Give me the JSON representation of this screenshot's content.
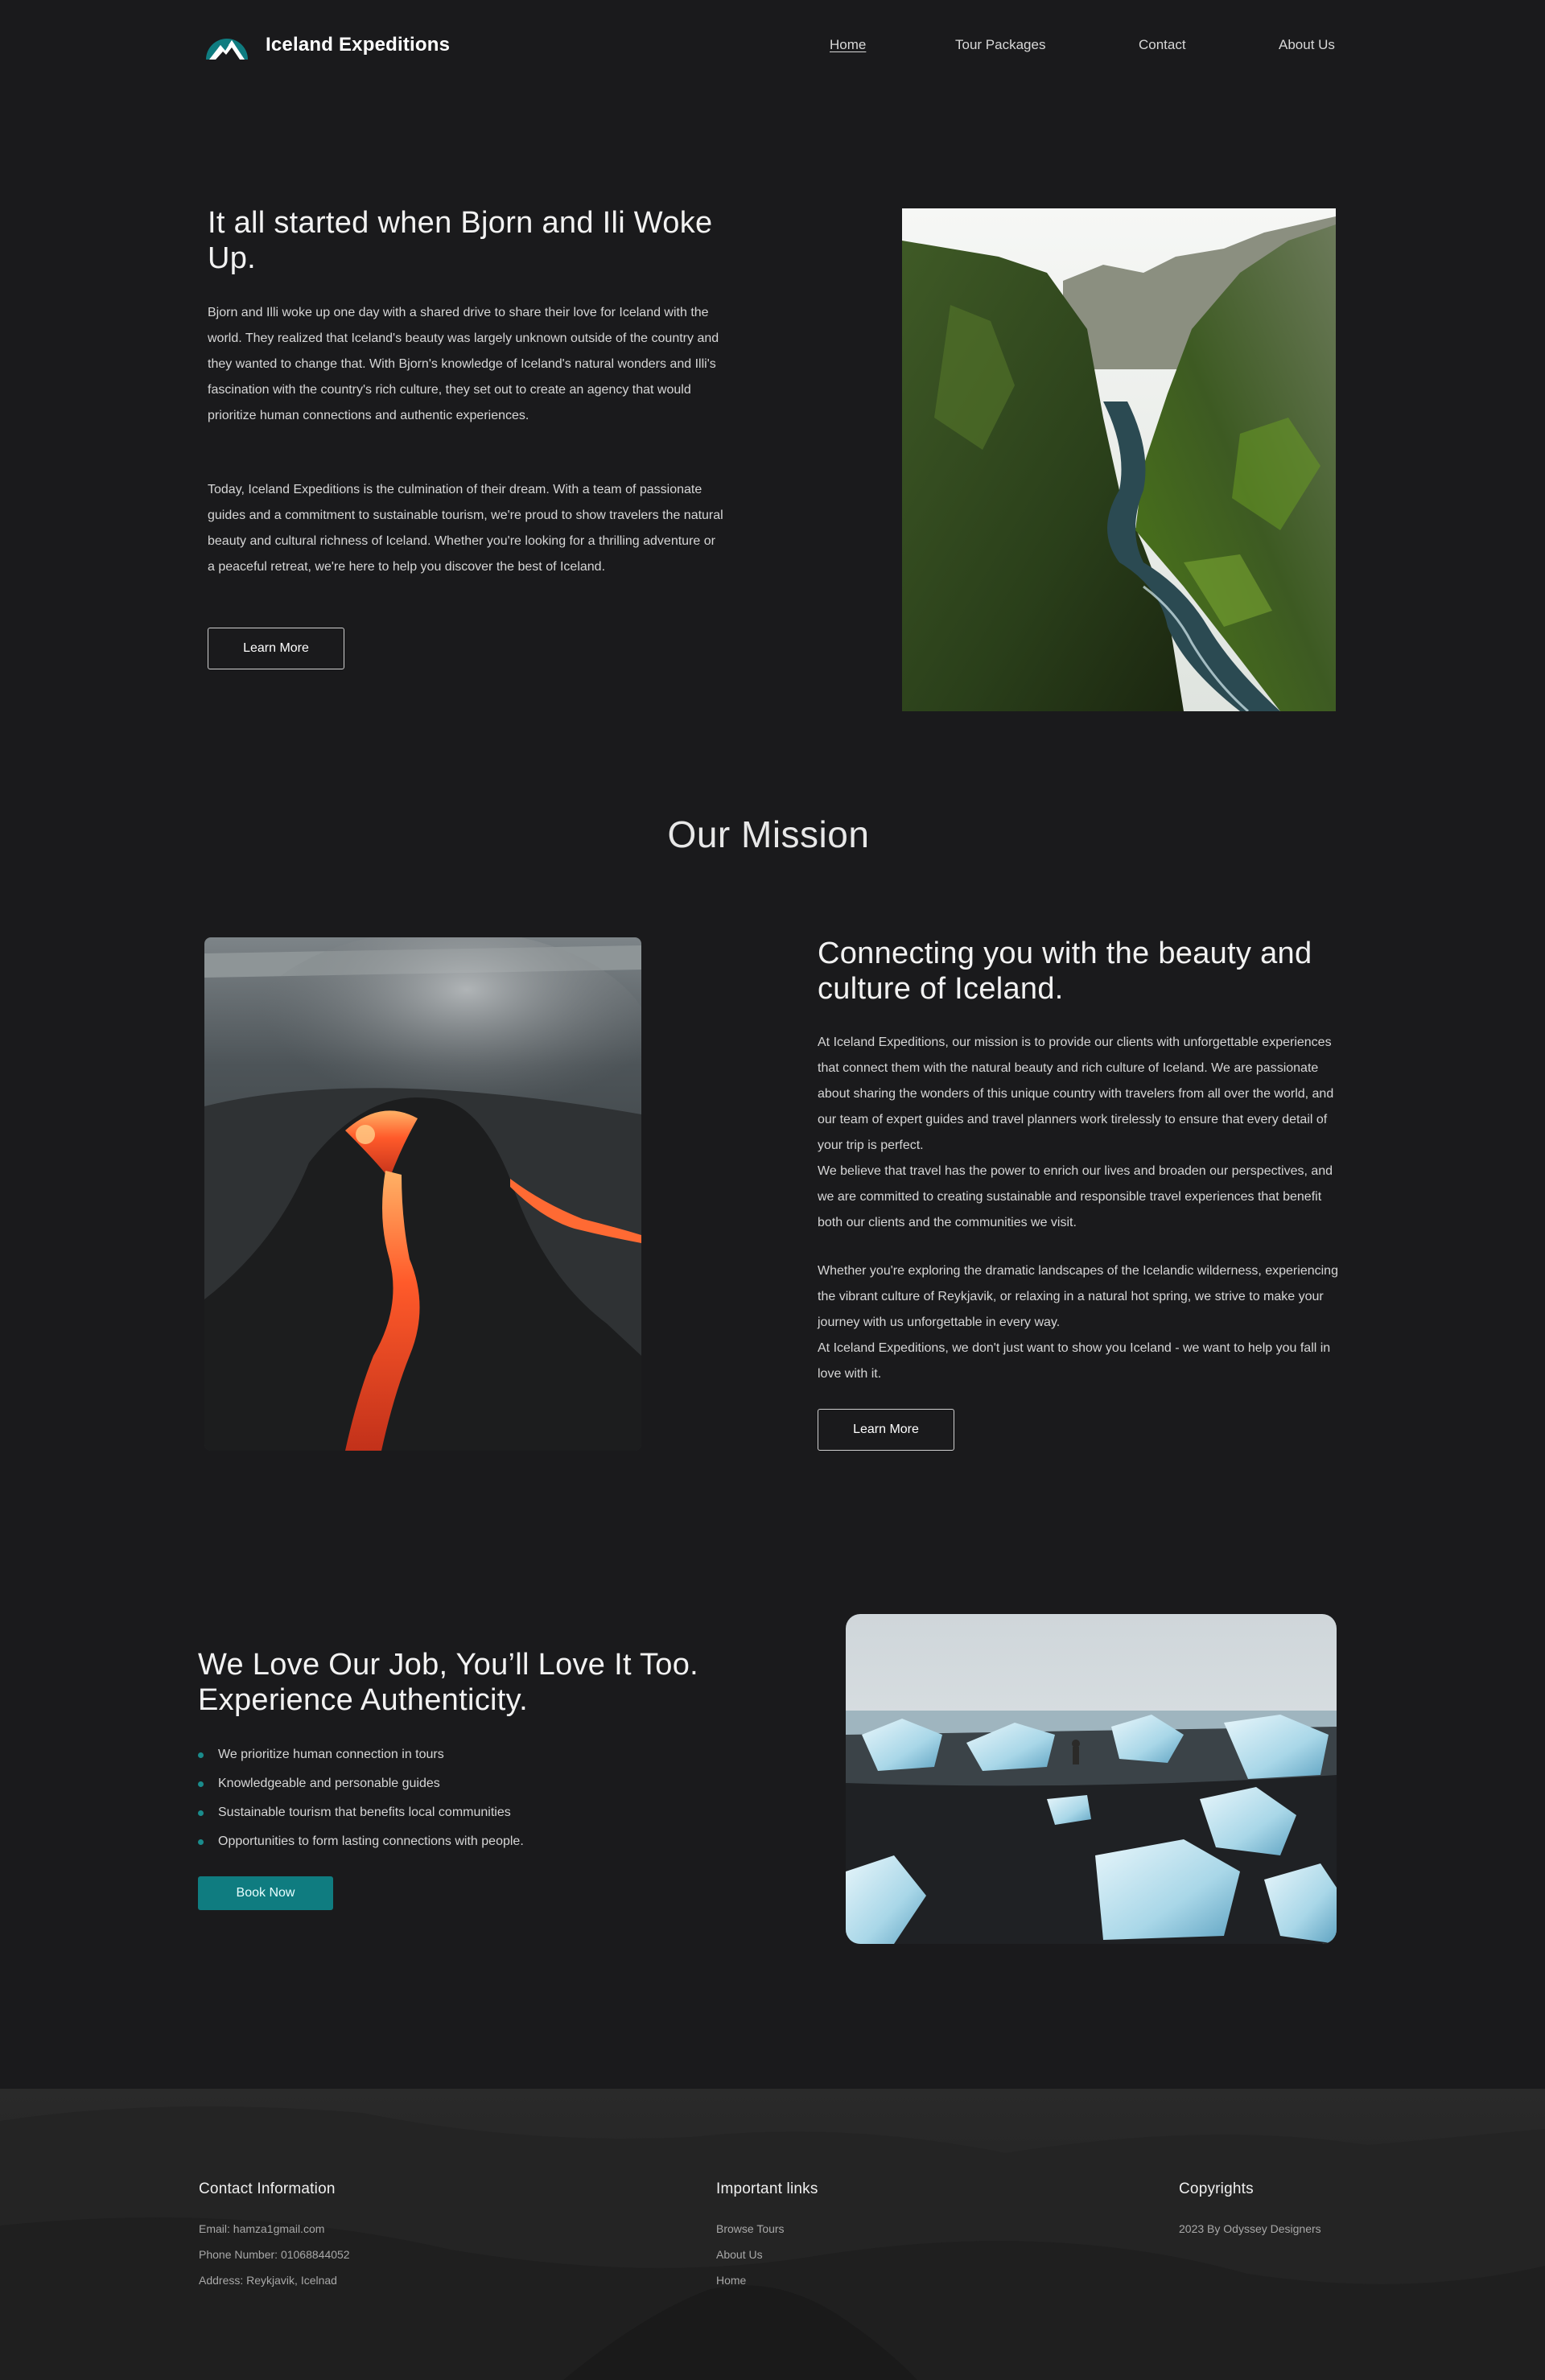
{
  "header": {
    "brand": "Iceland Expeditions",
    "nav": [
      {
        "label": "Home",
        "active": true
      },
      {
        "label": "Tour Packages",
        "active": false
      },
      {
        "label": "Contact",
        "active": false
      },
      {
        "label": "About Us",
        "active": false
      }
    ]
  },
  "story": {
    "title": "It all started when Bjorn and Ili Woke Up.",
    "paragraph1": "Bjorn and Illi woke up one day with a shared drive to share their love for Iceland with the world. They realized that Iceland's beauty was largely unknown outside of the country and they wanted to change that. With Bjorn's knowledge of Iceland's natural wonders and Illi's fascination with the country's rich culture, they set out to create an agency that would prioritize human connections and authentic experiences.",
    "paragraph2": "Today, Iceland Expeditions is the culmination of their dream. With a team of passionate guides and a commitment to sustainable tourism, we're proud to show travelers the natural beauty and cultural richness of Iceland. Whether you're looking for a thrilling adventure or a peaceful retreat, we're here to help you discover the best of Iceland.",
    "button": "Learn More"
  },
  "mission": {
    "heading": "Our Mission",
    "title": "Connecting you with the beauty and culture of Iceland.",
    "paragraph1_lines": [
      "At Iceland Expeditions, our mission is to provide our clients with unforgettable experiences that connect them with the natural beauty and rich culture of Iceland. We are passionate about sharing the wonders of this unique country with travelers from all over the world, and our team of expert guides and travel planners work tirelessly to ensure that every detail of your trip is perfect.",
      "We believe that travel has the power to enrich our lives and broaden our perspectives, and we are committed to creating sustainable and responsible travel experiences that benefit both our clients and the communities we visit."
    ],
    "paragraph2_lines": [
      "Whether you're exploring the dramatic landscapes of the Icelandic wilderness, experiencing the vibrant culture of Reykjavik, or relaxing in a natural hot spring, we strive to make your journey with us unforgettable in every way.",
      "At Iceland Expeditions, we don't just want to show you Iceland - we want to help you fall in love with it."
    ],
    "button": "Learn More"
  },
  "love": {
    "title": "We Love Our Job, You’ll Love It Too. Experience Authenticity.",
    "bullets": [
      "We prioritize human connection in tours",
      "Knowledgeable and personable guides",
      "Sustainable tourism that benefits local communities",
      "Opportunities to form lasting connections with people."
    ],
    "button": "Book Now"
  },
  "footer": {
    "contact": {
      "heading": "Contact Information",
      "email": "Email: hamza1gmail.com",
      "phone": "Phone Number: 01068844052",
      "address": "Address: Reykjavik, Icelnad"
    },
    "links": {
      "heading": "Important links",
      "items": [
        "Browse Tours",
        "About Us",
        "Home"
      ]
    },
    "copyright": {
      "heading": "Copyrights",
      "text": "2023 By Odyssey Designers"
    }
  },
  "colors": {
    "background": "#1a1a1c",
    "accent": "#0f7c80",
    "text": "#e4e4e4"
  }
}
